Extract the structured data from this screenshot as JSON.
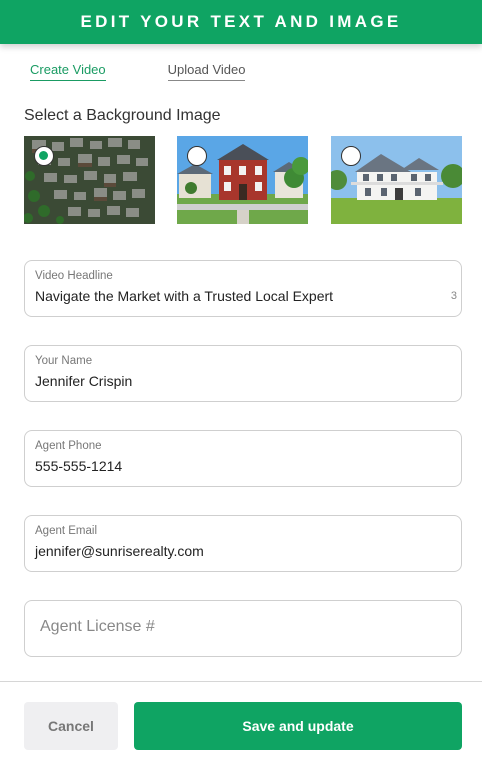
{
  "header": {
    "title": "EDIT YOUR TEXT AND IMAGE"
  },
  "tabs": [
    {
      "label": "Create Video",
      "active": true
    },
    {
      "label": "Upload Video",
      "active": false
    }
  ],
  "background": {
    "label": "Select a Background Image",
    "images": [
      {
        "name": "aerial-neighborhood",
        "selected": true
      },
      {
        "name": "red-brick-house",
        "selected": false
      },
      {
        "name": "white-farmhouse",
        "selected": false
      }
    ]
  },
  "form": {
    "headline": {
      "label": "Video Headline",
      "value": "Navigate the Market with a Trusted Local Expert",
      "count": "3"
    },
    "name": {
      "label": "Your Name",
      "value": "Jennifer Crispin"
    },
    "phone": {
      "label": "Agent Phone",
      "value": "555-555-1214"
    },
    "email": {
      "label": "Agent Email",
      "value": "jennifer@sunriserealty.com"
    },
    "license": {
      "placeholder": "Agent License #",
      "value": ""
    }
  },
  "footer": {
    "cancel_label": "Cancel",
    "save_label": "Save and update"
  },
  "colors": {
    "accent": "#0fa463"
  }
}
